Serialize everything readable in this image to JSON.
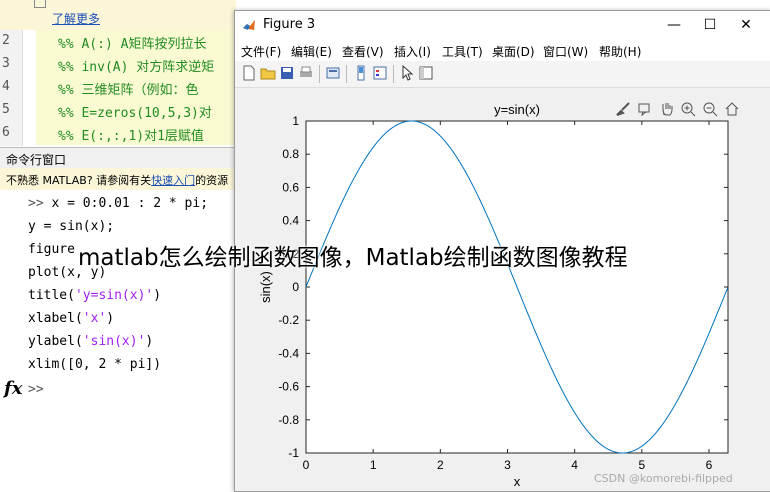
{
  "matlab": {
    "banner_link": "了解更多",
    "editor_lines": [
      {
        "num": "2",
        "code": "%% A(:) A矩阵按列拉长"
      },
      {
        "num": "3",
        "code": "%% inv(A) 对方阵求逆矩"
      },
      {
        "num": "4",
        "code": "%% 三维矩阵（例如：色"
      },
      {
        "num": "5",
        "code": "%% E=zeros(10,5,3)对"
      },
      {
        "num": "6",
        "code": "%% E(:,:,1)对1层赋值"
      }
    ],
    "command_window_title": "命令行窗口",
    "notice_prefix": "不熟悉 MATLAB? 请参阅有关",
    "notice_link": "快速入门",
    "notice_suffix": "的资源",
    "commands": [
      {
        "prompt": ">> ",
        "code": "x = 0:0.01 : 2 * pi;",
        "str": "",
        "tail": ""
      },
      {
        "prompt": "",
        "code": "y = sin(x);",
        "str": "",
        "tail": ""
      },
      {
        "prompt": "",
        "code": "figure",
        "str": "",
        "tail": ""
      },
      {
        "prompt": "",
        "code": "plot(x, y)",
        "str": "",
        "tail": ""
      },
      {
        "prompt": "",
        "code": "title(",
        "str": "'y=sin(x)'",
        "tail": ")"
      },
      {
        "prompt": "",
        "code": "xlabel(",
        "str": "'x'",
        "tail": ")"
      },
      {
        "prompt": "",
        "code": "ylabel(",
        "str": "'sin(x)'",
        "tail": ")"
      },
      {
        "prompt": "",
        "code": "xlim([0, 2 * pi])",
        "str": "",
        "tail": ""
      }
    ],
    "fx_label": "fx",
    "final_prompt": ">>"
  },
  "figure": {
    "window_title": "Figure 3",
    "minimize": "—",
    "maximize": "☐",
    "close": "✕",
    "menus": [
      "文件(F)",
      "编辑(E)",
      "查看(V)",
      "插入(I)",
      "工具(T)",
      "桌面(D)",
      "窗口(W)",
      "帮助(H)"
    ]
  },
  "chart_data": {
    "type": "line",
    "title": "y=sin(x)",
    "xlabel": "x",
    "ylabel": "sin(x)",
    "xlim": [
      0,
      6.2832
    ],
    "ylim": [
      -1,
      1
    ],
    "xticks": [
      "0",
      "1",
      "2",
      "3",
      "4",
      "5",
      "6"
    ],
    "yticks": [
      "-1",
      "-0.8",
      "-0.6",
      "-0.4",
      "-0.2",
      "0",
      "0.2",
      "0.4",
      "0.6",
      "0.8",
      "1"
    ],
    "function": "sin(x)",
    "x_step": 0.01,
    "line_color": "#0072bd",
    "grid": false
  },
  "overlay_title": "matlab怎么绘制函数图像，Matlab绘制函数图像教程",
  "watermark": "CSDN @komorebi-filpped"
}
